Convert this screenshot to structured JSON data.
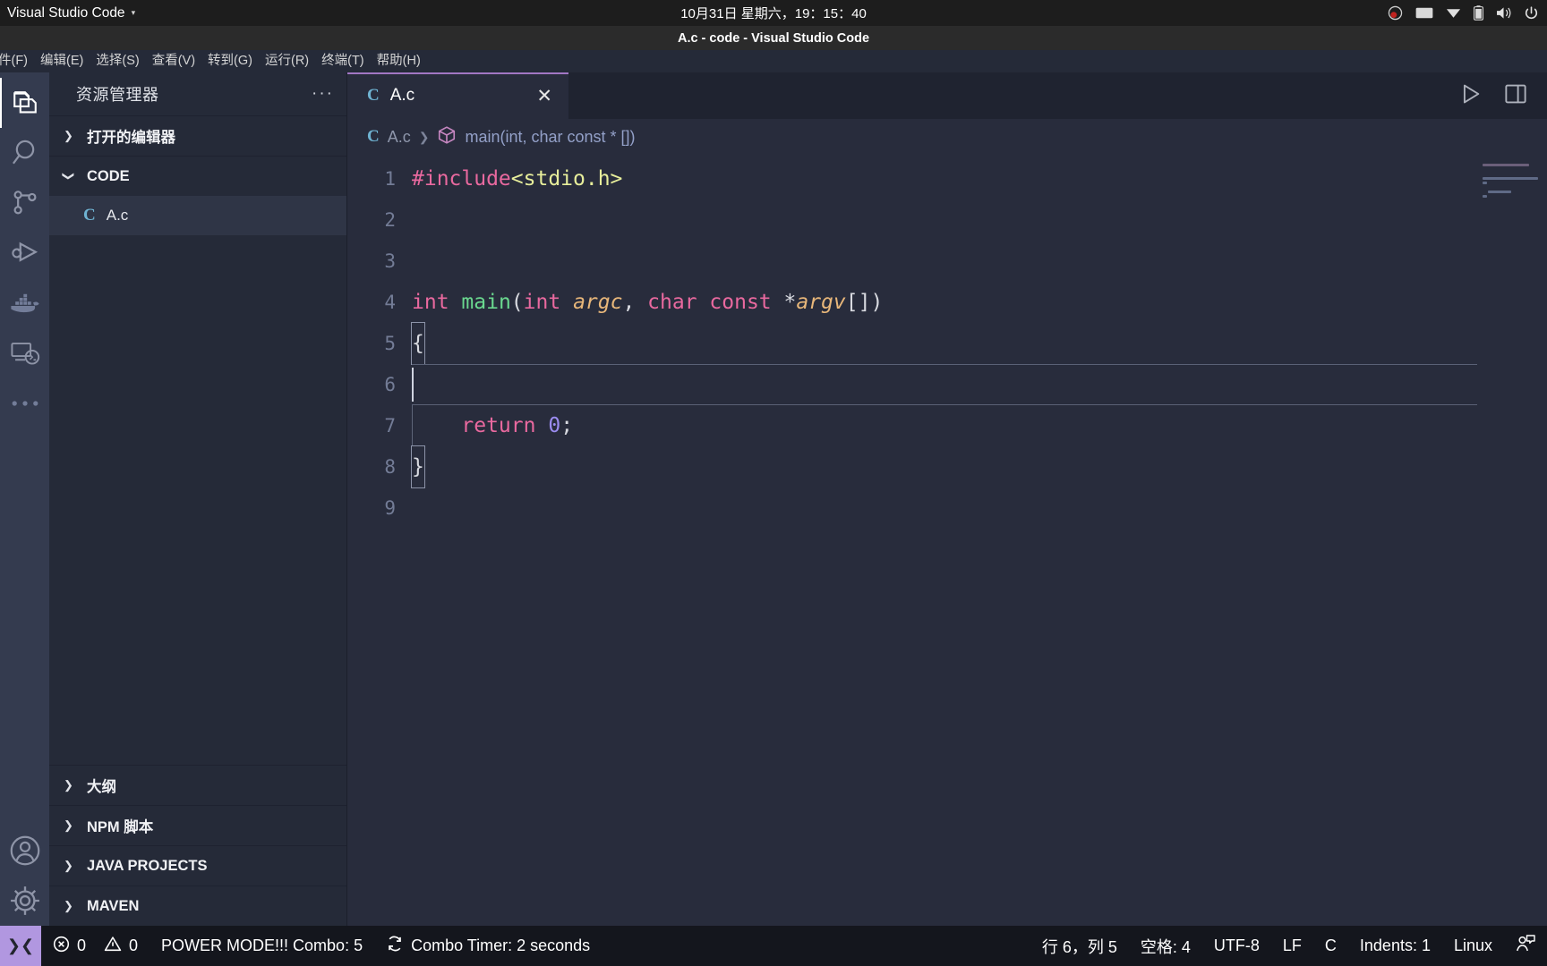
{
  "os_bar": {
    "app_name": "Visual Studio Code",
    "caret": "▾",
    "clock": "10月31日 星期六，19：15：40",
    "tray": [
      {
        "name": "obs-icon"
      },
      {
        "name": "keyboard-icon"
      },
      {
        "name": "network-icon"
      },
      {
        "name": "battery-icon"
      },
      {
        "name": "volume-icon"
      },
      {
        "name": "power-icon"
      }
    ]
  },
  "window": {
    "title": "A.c - code - Visual Studio Code"
  },
  "menu": {
    "items": [
      {
        "label": "件(F)"
      },
      {
        "label": "编辑(E)"
      },
      {
        "label": "选择(S)"
      },
      {
        "label": "查看(V)"
      },
      {
        "label": "转到(G)"
      },
      {
        "label": "运行(R)"
      },
      {
        "label": "终端(T)"
      },
      {
        "label": "帮助(H)"
      }
    ]
  },
  "activity_bar": {
    "items": [
      {
        "name": "explorer-icon",
        "active": true
      },
      {
        "name": "search-icon",
        "active": false
      },
      {
        "name": "source-control-icon",
        "active": false
      },
      {
        "name": "run-and-debug-icon",
        "active": false
      },
      {
        "name": "docker-icon",
        "active": false
      },
      {
        "name": "remote-explorer-icon",
        "active": false
      },
      {
        "name": "more-views-icon",
        "active": false
      }
    ],
    "bottom_items": [
      {
        "name": "account-icon"
      },
      {
        "name": "settings-gear-icon"
      }
    ]
  },
  "sidebar": {
    "title": "资源管理器",
    "more_actions": "···",
    "open_editors": {
      "label": "打开的编辑器",
      "expanded": false
    },
    "workspace": {
      "label": "CODE",
      "expanded": true
    },
    "files": [
      {
        "name": "A.c",
        "icon_letter": "C",
        "selected": true
      }
    ],
    "bottom_sections": [
      {
        "label": "大纲",
        "expanded": false
      },
      {
        "label": "NPM 脚本",
        "expanded": false
      },
      {
        "label": "JAVA PROJECTS",
        "expanded": false
      },
      {
        "label": "MAVEN",
        "expanded": false
      }
    ]
  },
  "editor": {
    "tab": {
      "label": "A.c",
      "icon_letter": "C",
      "close": "✕",
      "active": true
    },
    "actions": [
      {
        "name": "run-code-icon"
      },
      {
        "name": "split-editor-icon"
      }
    ],
    "breadcrumb": {
      "file_icon_letter": "C",
      "file": "A.c",
      "separator": "❯",
      "symbol": "main(int, char const * [])"
    },
    "lines": [
      {
        "num": "1",
        "tokens": [
          {
            "t": "#include",
            "c": "tok-pre"
          },
          {
            "t": "<stdio.h>",
            "c": "tok-str"
          }
        ]
      },
      {
        "num": "2",
        "tokens": []
      },
      {
        "num": "3",
        "tokens": []
      },
      {
        "num": "4",
        "tokens": [
          {
            "t": "int",
            "c": "tok-kw"
          },
          {
            "t": " ",
            "c": "tok-punct"
          },
          {
            "t": "main",
            "c": "tok-fn"
          },
          {
            "t": "(",
            "c": "tok-punct"
          },
          {
            "t": "int",
            "c": "tok-kw"
          },
          {
            "t": " ",
            "c": "tok-punct"
          },
          {
            "t": "argc",
            "c": "tok-param"
          },
          {
            "t": ", ",
            "c": "tok-punct"
          },
          {
            "t": "char",
            "c": "tok-kw"
          },
          {
            "t": " ",
            "c": "tok-punct"
          },
          {
            "t": "const",
            "c": "tok-kw"
          },
          {
            "t": " *",
            "c": "tok-punct"
          },
          {
            "t": "argv",
            "c": "tok-param"
          },
          {
            "t": "[])",
            "c": "tok-punct"
          }
        ]
      },
      {
        "num": "5",
        "tokens": [
          {
            "t": "{",
            "c": "tok-punct"
          }
        ]
      },
      {
        "num": "6",
        "tokens": [],
        "current": true
      },
      {
        "num": "7",
        "tokens": [
          {
            "t": "    ",
            "c": "tok-punct"
          },
          {
            "t": "return",
            "c": "tok-kw"
          },
          {
            "t": " ",
            "c": "tok-punct"
          },
          {
            "t": "0",
            "c": "tok-num"
          },
          {
            "t": ";",
            "c": "tok-punct"
          }
        ]
      },
      {
        "num": "8",
        "tokens": [
          {
            "t": "}",
            "c": "tok-punct"
          }
        ]
      },
      {
        "num": "9",
        "tokens": []
      }
    ]
  },
  "status_bar": {
    "remote_icon": "❯❮",
    "errors": {
      "icon": "error-icon",
      "count": "0"
    },
    "warnings": {
      "icon": "warning-icon",
      "count": "0"
    },
    "power_mode": "POWER MODE!!! Combo: 5",
    "combo_timer": "Combo Timer: 2 seconds",
    "cursor_position": "行 6，列 5",
    "indentation": "空格: 4",
    "encoding": "UTF-8",
    "eol": "LF",
    "language": "C",
    "indents": "Indents: 1",
    "platform": "Linux",
    "feedback_icon": "feedback-person-icon"
  },
  "colors": {
    "accent_tab": "#a277c4",
    "remote_bg": "#b197e0",
    "sidebar_bg": "#252a38",
    "editor_bg": "#282c3c",
    "activity_bg": "#343b4f",
    "status_bg": "#14161d"
  }
}
